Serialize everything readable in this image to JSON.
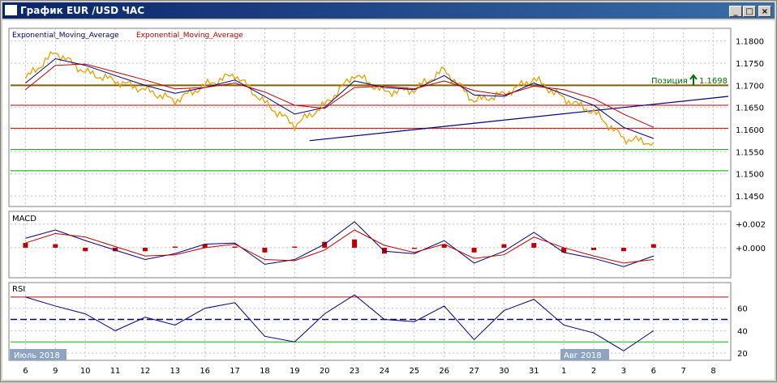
{
  "window": {
    "title": "График EUR /USD  ЧАС",
    "min_label": "_",
    "max_label": "□",
    "close_label": "×"
  },
  "price_panel": {
    "legend": [
      {
        "label": "Exponential_Moving_Average",
        "color": "#000080"
      },
      {
        "label": "Exponential_Moving_Average",
        "color": "#c00000"
      }
    ],
    "y_ticks": [
      "1.1800",
      "1.1750",
      "1.1700",
      "1.1650",
      "1.1600",
      "1.1550",
      "1.1500",
      "1.1450"
    ],
    "position_label": "Позиция",
    "position_price": "1.1698"
  },
  "macd_panel": {
    "label": "MACD",
    "y_ticks": [
      "+0.002",
      "+0.000"
    ]
  },
  "rsi_panel": {
    "label": "RSI",
    "y_ticks": [
      "60",
      "40",
      "20"
    ]
  },
  "x_axis": {
    "labels": [
      "6",
      "9",
      "10",
      "11",
      "12",
      "13",
      "16",
      "17",
      "18",
      "19",
      "20",
      "23",
      "24",
      "25",
      "26",
      "27",
      "30",
      "31",
      "1",
      "2",
      "3",
      "6",
      "7",
      "8"
    ],
    "month_labels": [
      "Июль 2018",
      "Авг 2018"
    ]
  },
  "chart_data": {
    "type": "line",
    "x": [
      "6",
      "9",
      "10",
      "11",
      "12",
      "13",
      "16",
      "17",
      "18",
      "19",
      "20",
      "23",
      "24",
      "25",
      "26",
      "27",
      "30",
      "31",
      "1",
      "2",
      "3",
      "6"
    ],
    "series": [
      {
        "name": "",
        "color": "#e8a000",
        "values": [
          1.1715,
          1.1775,
          1.173,
          1.171,
          1.169,
          1.1665,
          1.17,
          1.1725,
          1.166,
          1.161,
          1.1655,
          1.1725,
          1.1685,
          1.169,
          1.1735,
          1.1665,
          1.168,
          1.1715,
          1.167,
          1.164,
          1.158,
          1.157
        ]
      },
      {
        "name": "Exponential_Moving_Average",
        "color": "#000080",
        "values": [
          1.1705,
          1.176,
          1.1745,
          1.1722,
          1.17,
          1.1682,
          1.1695,
          1.1712,
          1.1675,
          1.1635,
          1.165,
          1.171,
          1.1695,
          1.169,
          1.1722,
          1.1678,
          1.1675,
          1.1705,
          1.168,
          1.1655,
          1.1605,
          1.158
        ]
      },
      {
        "name": "Exponential_Moving_Average",
        "color": "#c00000",
        "values": [
          1.169,
          1.1745,
          1.1748,
          1.173,
          1.1712,
          1.1692,
          1.1695,
          1.1705,
          1.1685,
          1.1655,
          1.1648,
          1.1695,
          1.1698,
          1.1692,
          1.171,
          1.1688,
          1.1678,
          1.1698,
          1.169,
          1.167,
          1.1635,
          1.1605
        ]
      }
    ],
    "horizontal_levels": [
      {
        "value": 1.17,
        "color": "#806000"
      },
      {
        "value": 1.1655,
        "color": "#c00000"
      },
      {
        "value": 1.1603,
        "color": "#c00000"
      },
      {
        "value": 1.1555,
        "color": "#00a000"
      },
      {
        "value": 1.1507,
        "color": "#00a000"
      }
    ],
    "trendline": {
      "from": [
        1.1575
      ],
      "to": [
        1.1675
      ],
      "color": "#000080"
    },
    "ylim": [
      1.143,
      1.1825
    ],
    "macd": {
      "line": [
        0.0008,
        0.0015,
        0.0006,
        -0.0002,
        -0.001,
        -0.0005,
        0.0003,
        0.0004,
        -0.0014,
        -0.001,
        0.0003,
        0.0022,
        -0.0003,
        -0.0005,
        0.0006,
        -0.0013,
        -0.0003,
        0.0013,
        -0.0004,
        -0.0009,
        -0.0016,
        -0.0007
      ],
      "signal": [
        0.0004,
        0.0012,
        0.0009,
        0.0001,
        -0.0007,
        -0.0006,
        0.0,
        0.0003,
        -0.001,
        -0.0011,
        -0.0002,
        0.0015,
        0.0002,
        -0.0004,
        0.0003,
        -0.0009,
        -0.0006,
        0.0009,
        0.0,
        -0.0007,
        -0.0013,
        -0.001
      ]
    },
    "rsi": {
      "values": [
        70,
        62,
        55,
        40,
        52,
        45,
        60,
        65,
        35,
        30,
        55,
        72,
        50,
        48,
        62,
        32,
        58,
        68,
        45,
        38,
        22,
        40
      ],
      "levels": [
        70,
        50,
        30
      ],
      "ylim": [
        15,
        80
      ]
    }
  }
}
